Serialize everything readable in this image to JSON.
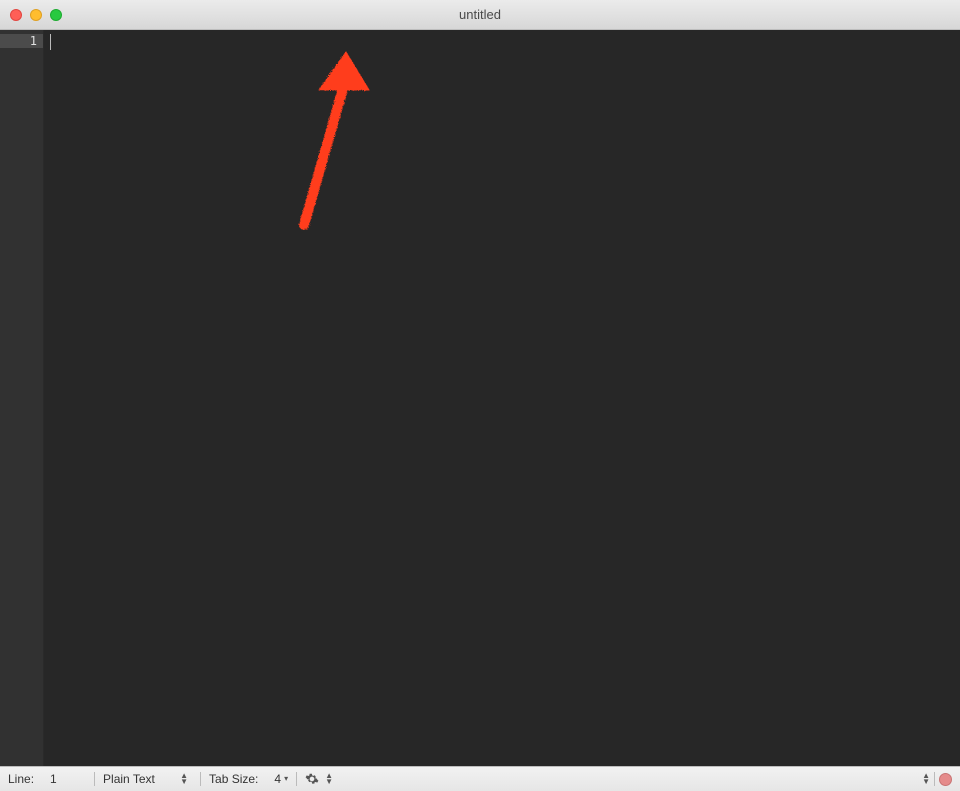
{
  "titlebar": {
    "title": "untitled"
  },
  "gutter": {
    "line_numbers": [
      "1"
    ],
    "current_index": 0
  },
  "editor": {
    "content": ""
  },
  "status": {
    "line_label": "Line:",
    "line_value": "1",
    "syntax_label": "Plain Text",
    "tab_label": "Tab Size:",
    "tab_value": "4"
  }
}
